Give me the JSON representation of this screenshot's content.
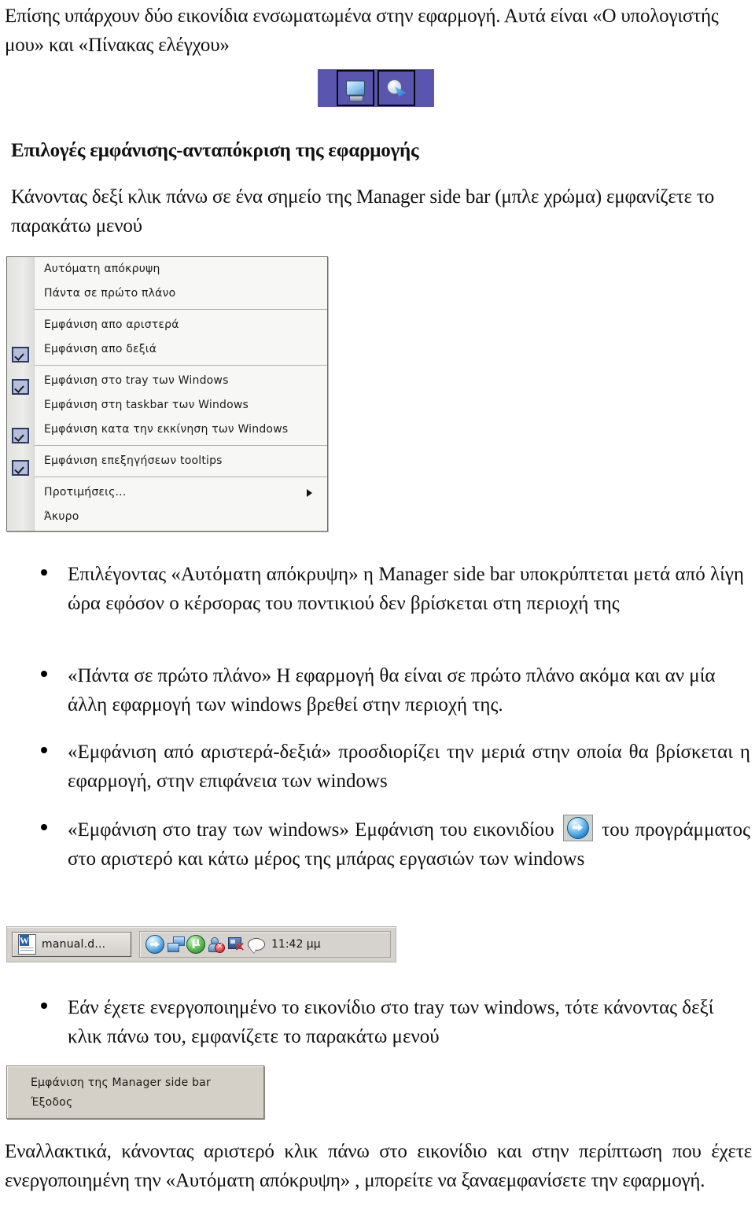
{
  "document": {
    "intro_paragraph": "Επίσης υπάρχουν δύο εικονίδια ενσωματωμένα στην εφαρμογή. Αυτά είναι «Ο υπολογιστής μου» και «Πίνακας ελέγχου»",
    "section_heading": "Επιλογές εμφάνισης-ανταπόκριση της εφαρμογής",
    "howto_paragraph": "Κάνοντας δεξί κλικ πάνω σε ένα σημείο της Manager side bar (μπλε χρώμα) εμφανίζετε το παρακάτω μενού",
    "closing_paragraph": "Εναλλακτικά, κάνοντας αριστερό κλικ πάνω στο εικονίδιο και στην περίπτωση που έχετε ενεργοποιημένη την «Αυτόματη απόκρυψη» , μπορείτε να  ξαναεμφανίσετε την εφαρμογή."
  },
  "embedded_icons": {
    "my_computer": "my-computer-icon",
    "control_panel": "control-panel-icon",
    "background_color": "#5a56b0"
  },
  "context_menu": {
    "items": [
      {
        "label": "Αυτόματη απόκρυψη",
        "checked": false,
        "submenu": false
      },
      {
        "label": "Πάντα σε πρώτο πλάνο",
        "checked": false,
        "submenu": false
      },
      {
        "separator": true
      },
      {
        "label": "Εμφάνιση απο αριστερά",
        "checked": false,
        "submenu": false
      },
      {
        "label": "Εμφάνιση απο δεξιά",
        "checked": true,
        "submenu": false
      },
      {
        "separator": true
      },
      {
        "label": "Εμφάνιση στο tray των Windows",
        "checked": true,
        "submenu": false
      },
      {
        "label": "Εμφάνιση στη taskbar των Windows",
        "checked": false,
        "submenu": false
      },
      {
        "label": "Εμφάνιση κατα την εκκίνηση των Windows",
        "checked": true,
        "submenu": false
      },
      {
        "separator": true
      },
      {
        "label": "Εμφάνιση επεξηγήσεων tooltips",
        "checked": true,
        "submenu": false
      },
      {
        "separator": true
      },
      {
        "label": "Προτιμήσεις...",
        "checked": false,
        "submenu": true
      },
      {
        "label": "Άκυρο",
        "checked": false,
        "submenu": false
      }
    ]
  },
  "bullets": {
    "b1": "Επιλέγοντας «Αυτόματη απόκρυψη» η Manager side bar υποκρύπτεται μετά από λίγη ώρα εφόσον ο κέρσορας  του ποντικιού δεν βρίσκεται στη περιοχή της",
    "b2": "«Πάντα σε πρώτο πλάνο» Η εφαρμογή θα είναι σε πρώτο πλάνο ακόμα και αν μία άλλη εφαρμογή των windows βρεθεί στην περιοχή της.",
    "b3": "«Εμφάνιση από αριστερά-δεξιά» προσδιορίζει την μεριά στην οποία θα βρίσκεται η εφαρμογή, στην επιφάνεια των windows",
    "b4_part1": "«Εμφάνιση στο tray των windows» Εμφάνιση του εικονιδίου",
    "b4_part2": "του προγράμματος στο αριστερό και κάτω μέρος της μπάρας εργασιών των windows",
    "b5": "Εάν έχετε ενεργοποιημένο το εικονίδιο στο tray των windows, τότε κάνοντας δεξί κλικ πάνω του, εμφανίζετε το παρακάτω μενού"
  },
  "taskbar": {
    "task_button_label": "manual.d...",
    "task_button_icon": "word-document-icon",
    "tray_icons": [
      "manager-sidebar-icon",
      "network-connections-icon",
      "utorrent-icon",
      "user-accounts-icon",
      "monitor-disconnected-icon",
      "message-bubble-icon"
    ],
    "clock": "11:42 μμ"
  },
  "tray_context_menu": {
    "items": [
      "Εμφάνιση της Manager side bar",
      "Έξοδος"
    ]
  }
}
